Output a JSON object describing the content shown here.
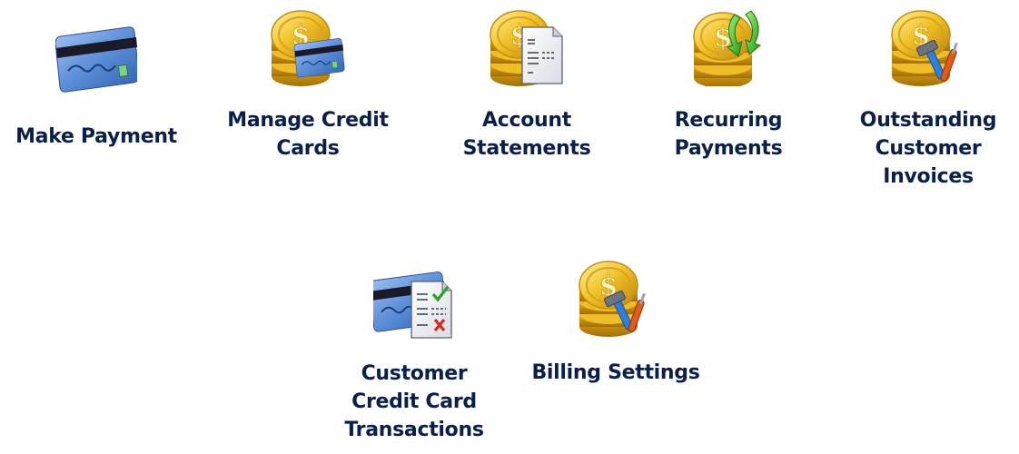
{
  "items": [
    {
      "id": "make-payment",
      "label_lines": [
        "Make Payment"
      ],
      "icon": "credit-card-icon"
    },
    {
      "id": "manage-credit-cards",
      "label_lines": [
        "Manage Credit",
        "Cards"
      ],
      "icon": "coins-credit-card-icon"
    },
    {
      "id": "account-statements",
      "label_lines": [
        "Account",
        "Statements"
      ],
      "icon": "coins-statement-icon"
    },
    {
      "id": "recurring-payments",
      "label_lines": [
        "Recurring",
        "Payments"
      ],
      "icon": "coins-recurring-arrows-icon"
    },
    {
      "id": "outstanding-customer-invoices",
      "label_lines": [
        "Outstanding",
        "Customer",
        "Invoices"
      ],
      "icon": "coins-tools-icon"
    },
    {
      "id": "customer-credit-card-transactions",
      "label_lines": [
        "Customer",
        "Credit Card",
        "Transactions"
      ],
      "icon": "credit-card-checklist-icon"
    },
    {
      "id": "billing-settings",
      "label_lines": [
        "Billing Settings"
      ],
      "icon": "coins-tools-icon"
    }
  ],
  "colors": {
    "label_text": "#0a1f4a",
    "coin_gold": "#e8b21a",
    "card_blue": "#4f7fd0",
    "arrow_green": "#3dbf2a",
    "check_green": "#27a02a",
    "cross_red": "#d8261c"
  }
}
